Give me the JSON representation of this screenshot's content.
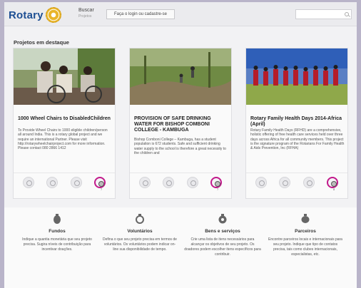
{
  "header": {
    "logo_text": "Rotary",
    "search_label": "Buscar",
    "search_sub": "Projetos",
    "login_label": "Faça o login ou cadastre-se",
    "search_placeholder": ""
  },
  "featured_title": "Projetos em destaque",
  "cards": [
    {
      "title": "1000 Wheel Chairs to DisabledChildren",
      "description": "To Provide Wheel Chairs to 1000 eligible children/person all around India. This is a rotary global project and we require an international Partner. Please visit http://rotarywheelchairproject.com for more information. Please contact 080 2866 1412",
      "count": "7"
    },
    {
      "title": "PROVISION OF SAFE DRINKING WATER FOR BISHOP COMBONI COLLEGE - KAMBUGA",
      "description": "Bishop Comboni College – Kambuga, has a student population is 672 students. Safe and sufficient drinking water supply to the school is therefore a great necessity to the children and",
      "count": "7"
    },
    {
      "title": "Rotary Family Health Days 2014-Africa (April)",
      "description": "Rotary Family Health Days (RFHD) are a comprehensive, holistic offering of free health care services held over three days across Africa for all community members. This project is the signature program of the Rotarians For Family Health & Aids Prevention, Inc (RFHA)",
      "count": "8"
    }
  ],
  "features": [
    {
      "icon": "coin-icon",
      "title": "Fundos",
      "text": "Indique a quantia monetária que seu projeto precisa. Sugira níveis de contribuição para incentivar doações."
    },
    {
      "icon": "ring-icon",
      "title": "Voluntários",
      "text": "Defina o que seu projeto precisa em termos de voluntários. Os voluntários podem indicar on-line sua disponibilidade de tempo."
    },
    {
      "icon": "gift-icon",
      "title": "Bens e serviços",
      "text": "Crie uma lista de itens necessários para alcançar os objetivos de seu projeto. Os doadores podem escolher itens específicos para contribuir."
    },
    {
      "icon": "handshake-icon",
      "title": "Parceiros",
      "text": "Encontre parceiros locais e internacionais para seu projeto. Indique que tipo de contatos precisa, tais como clubes internacionais, especialistas, etc."
    }
  ],
  "colors": {
    "accent": "#c2198b",
    "brand": "#1e4f93",
    "gold": "#e9b52a"
  }
}
